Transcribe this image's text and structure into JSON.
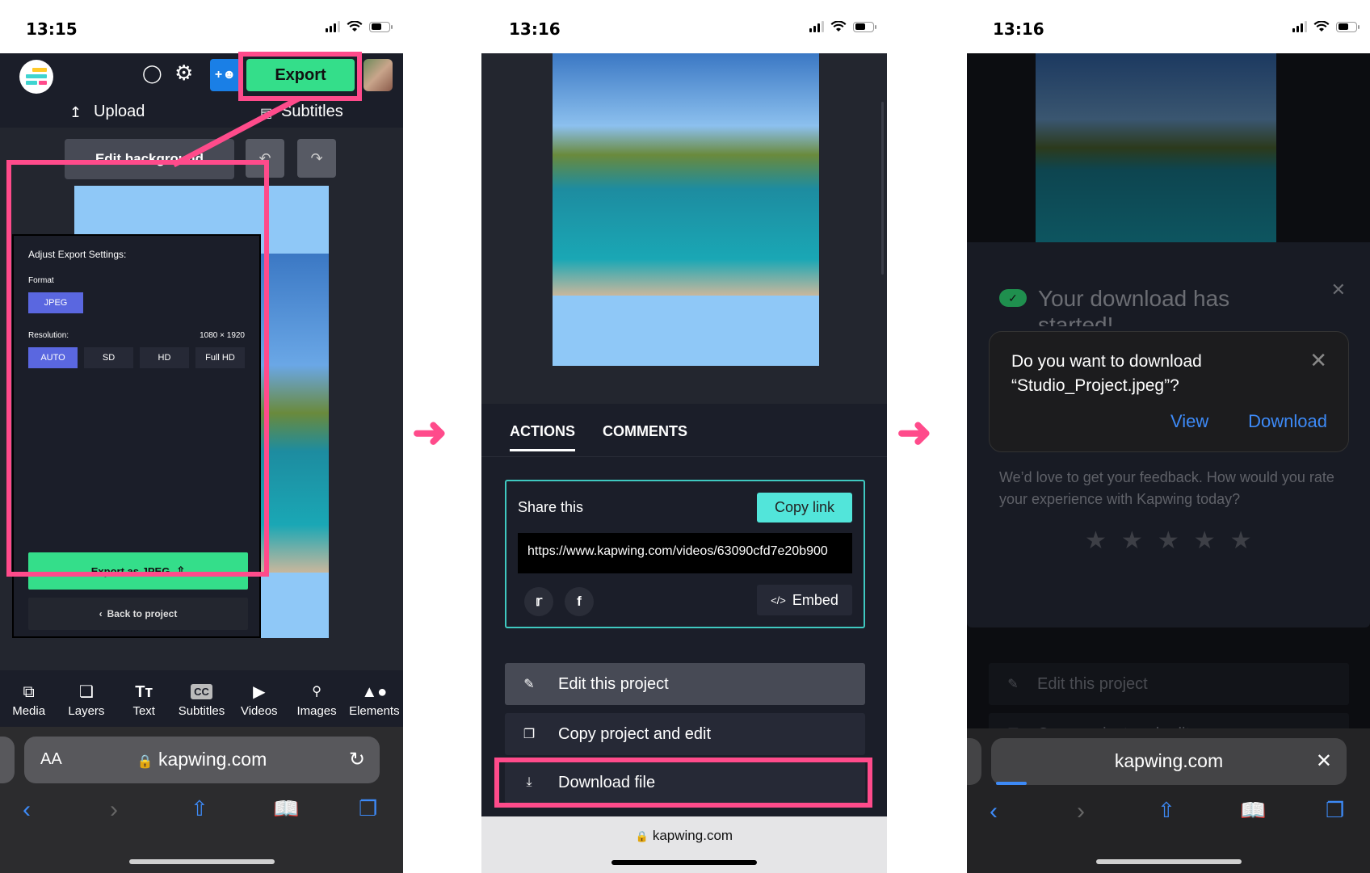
{
  "panels": [
    {
      "status_time": "13:15",
      "app": {
        "toolbar": {
          "export_label": "Export",
          "upload_label": "Upload",
          "subtitles_label": "Subtitles",
          "edit_background_label": "Edit background"
        },
        "export_settings": {
          "title": "Adjust Export Settings:",
          "format_label": "Format",
          "format_value": "JPEG",
          "resolution_label": "Resolution:",
          "resolution_dims": "1080 × 1920",
          "resolution_options": [
            "AUTO",
            "SD",
            "HD",
            "Full HD"
          ],
          "resolution_selected": "AUTO",
          "export_button": "Export as JPEG",
          "back_button": "Back to project"
        },
        "bottom_tools": [
          {
            "label": "Media",
            "icon": "media-add-icon"
          },
          {
            "label": "Layers",
            "icon": "layers-icon"
          },
          {
            "label": "Text",
            "icon": "text-icon"
          },
          {
            "label": "Subtitles",
            "icon": "cc-icon"
          },
          {
            "label": "Videos",
            "icon": "video-icon"
          },
          {
            "label": "Images",
            "icon": "search-icon"
          },
          {
            "label": "Elements",
            "icon": "shapes-icon"
          }
        ]
      },
      "browser": {
        "text_size_label": "AA",
        "url": "kapwing.com"
      }
    },
    {
      "status_time": "13:16",
      "tabs": [
        "ACTIONS",
        "COMMENTS"
      ],
      "active_tab": "ACTIONS",
      "share": {
        "title": "Share this",
        "copy_link_label": "Copy link",
        "url": "https://www.kapwing.com/videos/63090cfd7e20b900",
        "embed_label": "Embed"
      },
      "actions": [
        {
          "label": "Edit this project",
          "icon": "pencil-icon"
        },
        {
          "label": "Copy project and edit",
          "icon": "copy-icon"
        },
        {
          "label": "Download file",
          "icon": "download-icon"
        }
      ],
      "browser": {
        "url": "kapwing.com"
      }
    },
    {
      "status_time": "13:16",
      "modal": {
        "title": "Your download has",
        "title_line2": "started!",
        "feedback": "We’d love to get your feedback. How would you rate your experience with Kapwing today?",
        "rating_max": 5,
        "rating_value": 0
      },
      "ios_prompt": {
        "question_line1": "Do you want to download",
        "question_line2": "“Studio_Project.jpeg”?",
        "view_label": "View",
        "download_label": "Download"
      },
      "background_actions": [
        "Edit this project",
        "Copy project and edit"
      ],
      "browser": {
        "url": "kapwing.com"
      }
    }
  ],
  "colors": {
    "highlight": "#ff4b8b",
    "export_green": "#34de8a",
    "accent_blue": "#5a67e0",
    "teal": "#52e5da",
    "ios_blue": "#3d8af7"
  }
}
